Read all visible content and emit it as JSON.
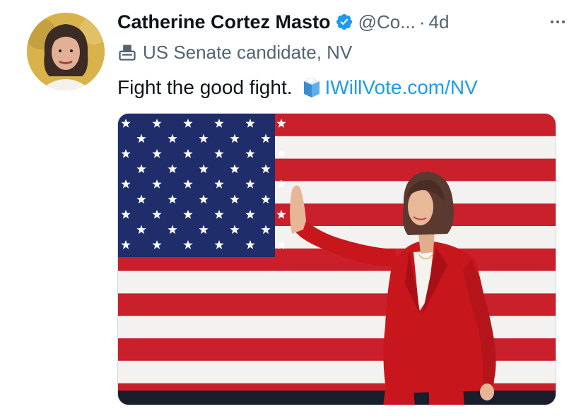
{
  "tweet": {
    "author_name": "Catherine Cortez Masto",
    "handle": "@Co...",
    "separator": "·",
    "time": "4d",
    "label": "US Senate candidate, NV",
    "text": "Fight the good fight.",
    "link": "IWillVote.com/NV"
  },
  "icons": {
    "verified": "verified-badge-icon",
    "label": "ballot-box-icon",
    "emoji": "ballot-box-emoji-icon",
    "more": "more-icon"
  },
  "colors": {
    "accent": "#1d9bf0",
    "secondary_text": "#536471",
    "flag_red": "#c9202b",
    "flag_blue": "#1f2d6b",
    "suit_red": "#c8161d"
  }
}
